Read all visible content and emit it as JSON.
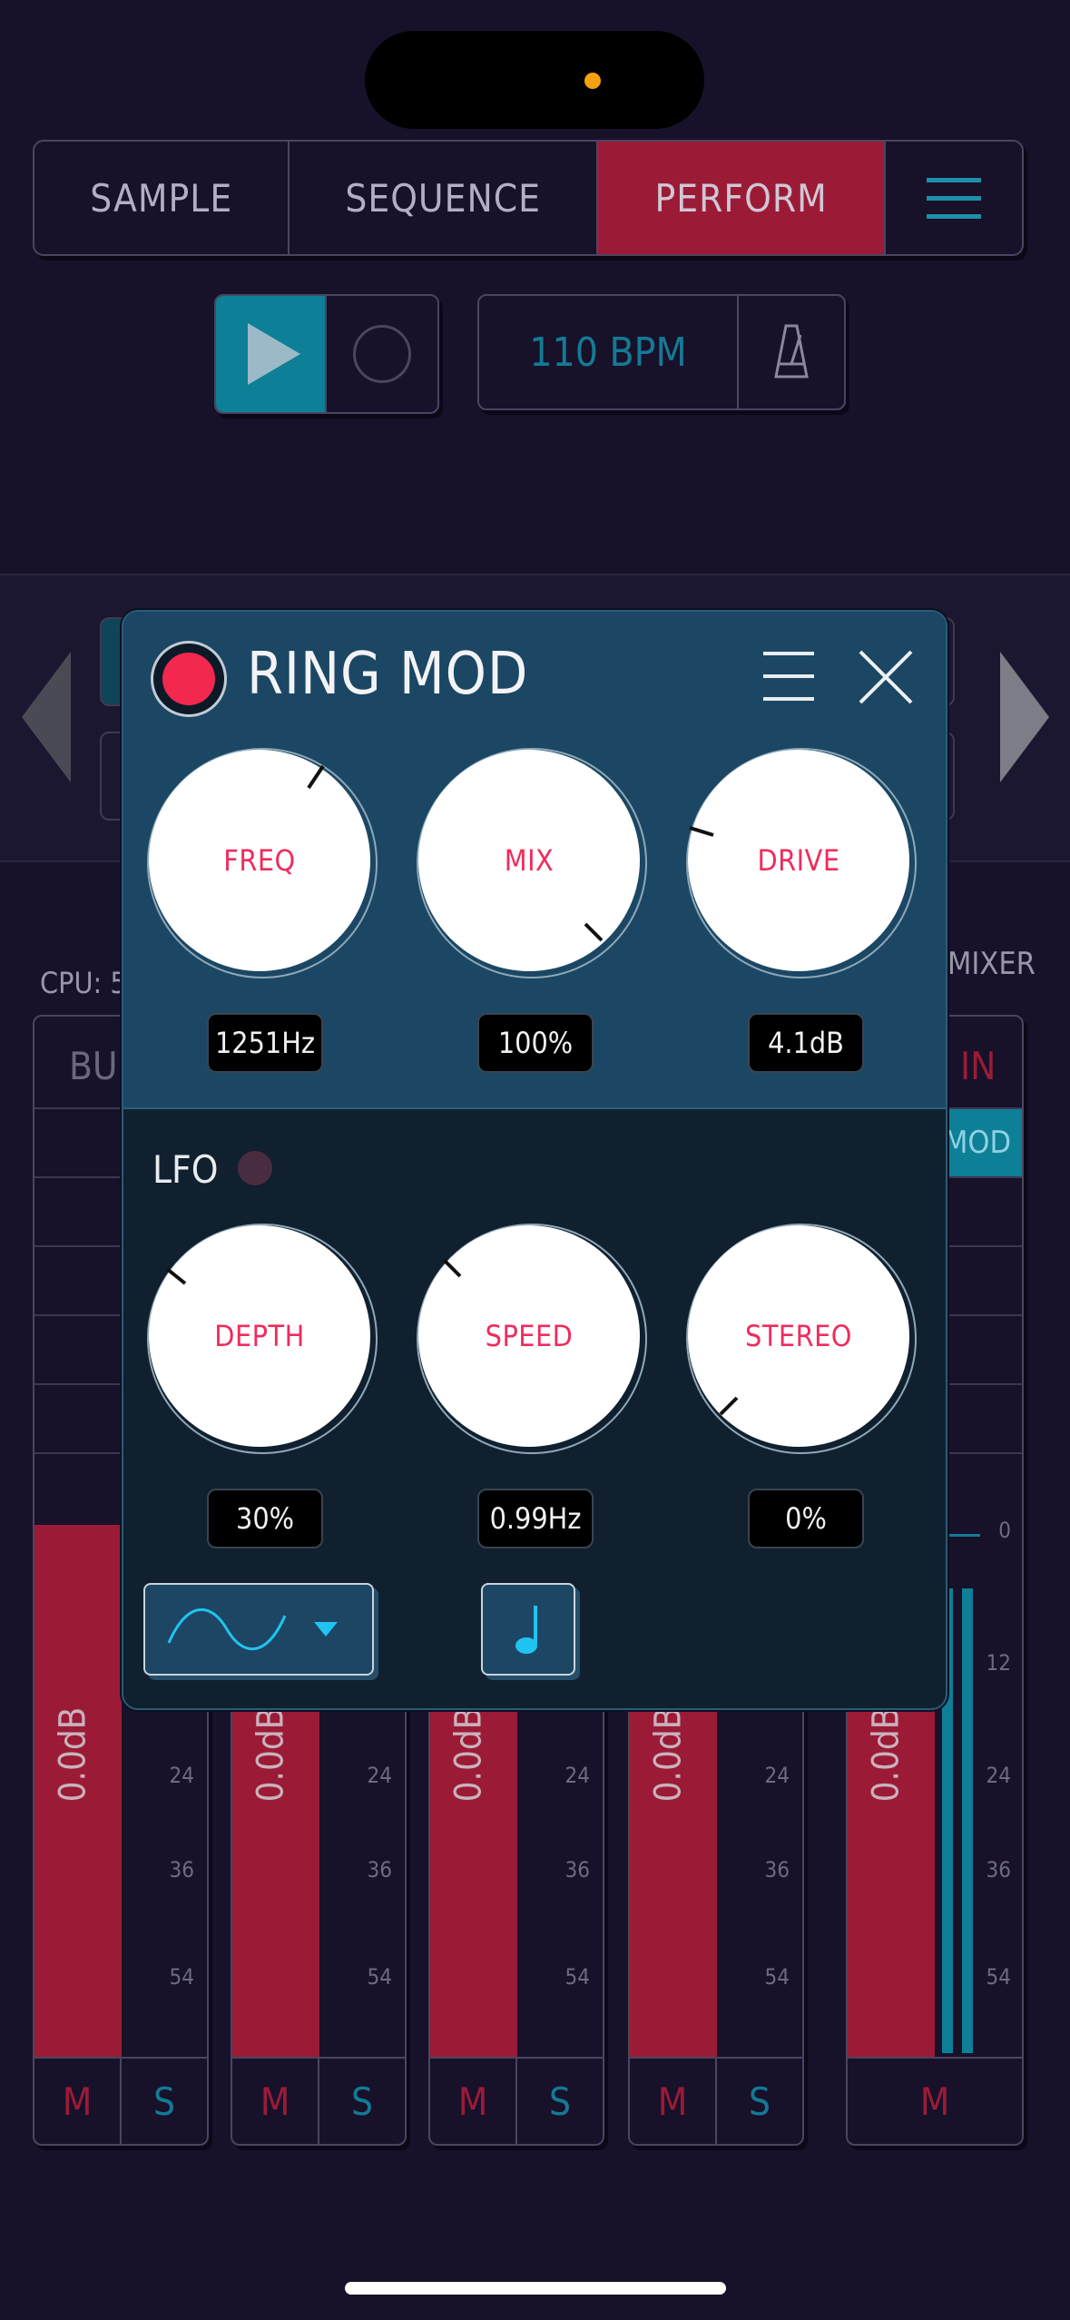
{
  "tabs": [
    "SAMPLE",
    "SEQUENCE",
    "PERFORM"
  ],
  "active_tab": "PERFORM",
  "transport": {
    "bpm": "110 BPM"
  },
  "status": {
    "cpu": "CPU: 5",
    "mixer": "MIXER"
  },
  "strips": [
    {
      "name": "BUS",
      "level": "0.0dB",
      "m": "M",
      "s": "S"
    },
    {
      "name": "",
      "level": "0.0dB",
      "m": "M",
      "s": "S"
    },
    {
      "name": "",
      "level": "0.0dB",
      "m": "M",
      "s": "S"
    },
    {
      "name": "",
      "level": "0.0dB",
      "m": "M",
      "s": "S"
    },
    {
      "name": "IN",
      "level": "0.0dB",
      "m": "M",
      "fx": "MOD"
    }
  ],
  "meter_ticks": [
    "24",
    "36",
    "54"
  ],
  "master_ticks": [
    "0",
    "12",
    "24",
    "36",
    "54"
  ],
  "effect": {
    "title": "RING MOD",
    "enabled": true,
    "knobs": [
      {
        "label": "FREQ",
        "value": "1251Hz"
      },
      {
        "label": "MIX",
        "value": "100%"
      },
      {
        "label": "DRIVE",
        "value": "4.1dB"
      }
    ],
    "lfo": {
      "label": "LFO",
      "enabled": false,
      "knobs": [
        {
          "label": "DEPTH",
          "value": "30%"
        },
        {
          "label": "SPEED",
          "value": "0.99Hz"
        },
        {
          "label": "STEREO",
          "value": "0%"
        }
      ],
      "waveform": "sine-wave-icon",
      "sync_icon": "quarter-note-icon"
    }
  },
  "colors": {
    "accent_red": "#ef2c5c",
    "accent_teal": "#0d7f97",
    "fader": "#9b1b36"
  }
}
